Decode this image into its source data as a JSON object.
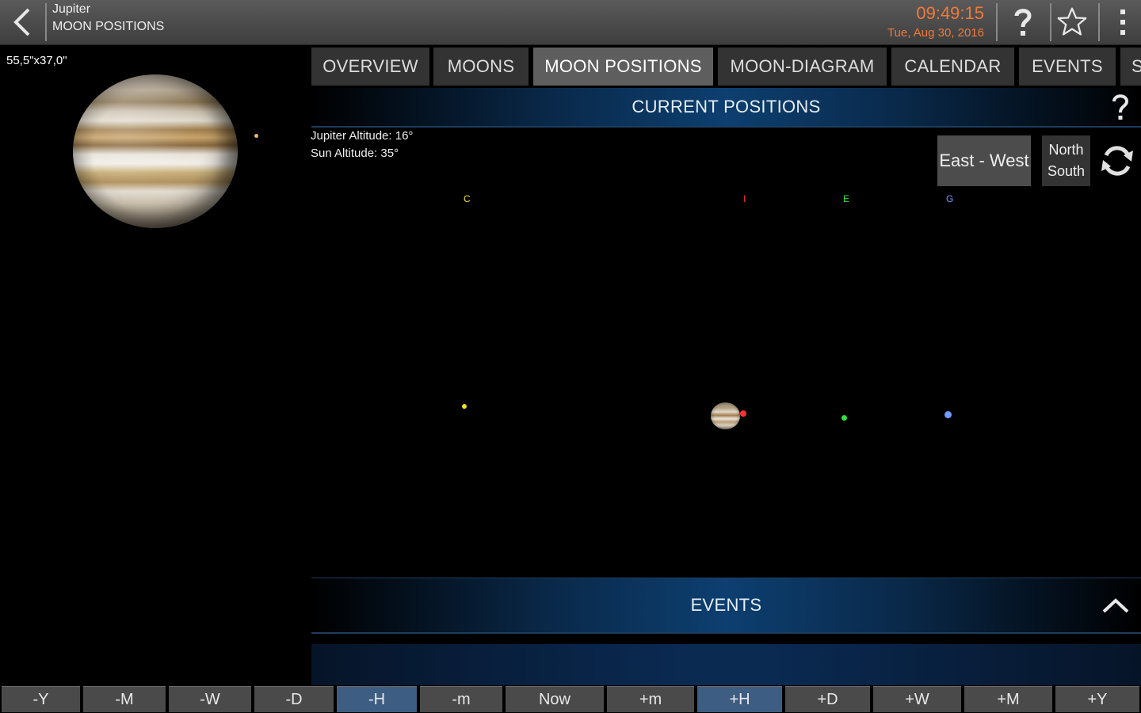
{
  "header": {
    "title": "Jupiter",
    "subtitle": "MOON POSITIONS",
    "time": "09:49:15",
    "date": "Tue, Aug 30, 2016"
  },
  "left_panel": {
    "fov": "55,5\"x37,0\""
  },
  "tabs": [
    {
      "label": "OVERVIEW",
      "active": false
    },
    {
      "label": "MOONS",
      "active": false
    },
    {
      "label": "MOON POSITIONS",
      "active": true
    },
    {
      "label": "MOON-DIAGRAM",
      "active": false
    },
    {
      "label": "CALENDAR",
      "active": false
    },
    {
      "label": "EVENTS",
      "active": false
    },
    {
      "label": "S",
      "active": false
    }
  ],
  "current_positions": {
    "title": "CURRENT POSITIONS",
    "jupiter_altitude": "Jupiter Altitude: 16°",
    "sun_altitude": "Sun Altitude: 35°",
    "east_west_label": "East - West",
    "north_label": "North",
    "south_label": "South",
    "moons": [
      {
        "label": "C",
        "color": "#f0e020"
      },
      {
        "label": "I",
        "color": "#ff3030"
      },
      {
        "label": "E",
        "color": "#30e040"
      },
      {
        "label": "G",
        "color": "#6f9dff"
      }
    ]
  },
  "events_section": {
    "title": "EVENTS"
  },
  "time_controls": [
    {
      "label": "-Y",
      "active": false
    },
    {
      "label": "-M",
      "active": false
    },
    {
      "label": "-W",
      "active": false
    },
    {
      "label": "-D",
      "active": false
    },
    {
      "label": "-H",
      "active": true
    },
    {
      "label": "-m",
      "active": false
    },
    {
      "label": "Now",
      "active": false
    },
    {
      "label": "+m",
      "active": false
    },
    {
      "label": "+H",
      "active": true
    },
    {
      "label": "+D",
      "active": false
    },
    {
      "label": "+W",
      "active": false
    },
    {
      "label": "+M",
      "active": false
    },
    {
      "label": "+Y",
      "active": false
    }
  ],
  "colors": {
    "clock": "#f07a3a",
    "accent_blue": "#0d3f70",
    "active_time_control": "#3e5d82"
  }
}
